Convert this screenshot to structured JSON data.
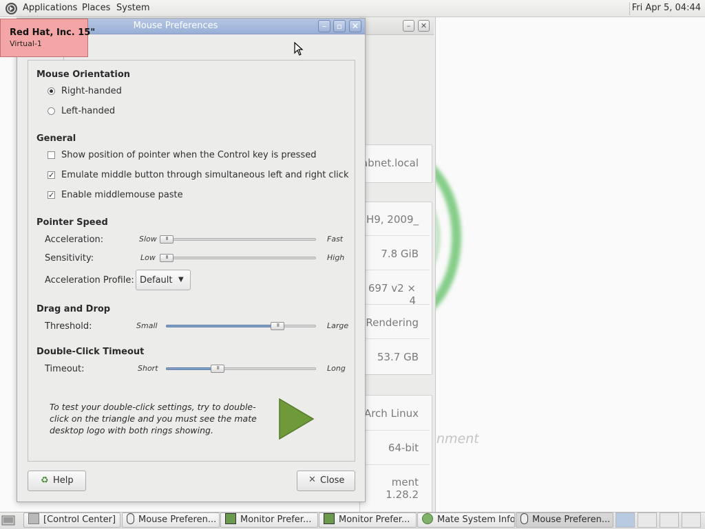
{
  "top_panel": {
    "menus": [
      "Applications",
      "Places",
      "System"
    ],
    "clock": "Fri Apr  5, 04:44"
  },
  "tooltip": {
    "title": "Red Hat, Inc. 15\"",
    "subtitle": "Virtual-1"
  },
  "background_window": {
    "values": [
      "abnet.local",
      "H9, 2009_",
      "7.8 GiB",
      "697 v2 × 4",
      "Rendering",
      "53.7 GB",
      "Arch Linux",
      "64-bit",
      "ment 1.28.2"
    ],
    "partial_text": "nment"
  },
  "dialog": {
    "title": "Mouse Preferences",
    "orientation": {
      "heading": "Mouse Orientation",
      "right_handed": "Right-handed",
      "left_handed": "Left-handed",
      "selected": "Right-handed"
    },
    "general": {
      "heading": "General",
      "show_position": "Show position of pointer when the Control key is pressed",
      "show_position_checked": false,
      "emulate_middle": "Emulate middle button through simultaneous left and right click",
      "emulate_middle_checked": true,
      "middle_paste": "Enable middlemouse paste",
      "middle_paste_checked": true
    },
    "pointer_speed": {
      "heading": "Pointer Speed",
      "acceleration_label": "Acceleration:",
      "acceleration_min": "Slow",
      "acceleration_max": "Fast",
      "acceleration_value": 0.0,
      "sensitivity_label": "Sensitivity:",
      "sensitivity_min": "Low",
      "sensitivity_max": "High",
      "sensitivity_value": 0.0,
      "profile_label": "Acceleration Profile:",
      "profile_value": "Default"
    },
    "drag_drop": {
      "heading": "Drag and Drop",
      "threshold_label": "Threshold:",
      "threshold_min": "Small",
      "threshold_max": "Large",
      "threshold_value": 0.77
    },
    "double_click": {
      "heading": "Double-Click Timeout",
      "timeout_label": "Timeout:",
      "timeout_min": "Short",
      "timeout_max": "Long",
      "timeout_value": 0.33,
      "hint": "To test your double-click settings, try to double-click on the triangle and you must see the mate desktop logo with both rings showing."
    },
    "buttons": {
      "help": "Help",
      "close": "Close"
    }
  },
  "taskbar": {
    "tasks": [
      "[Control Center]",
      "Mouse Preferen...",
      "Monitor Prefer...",
      "Monitor Prefer...",
      "Mate System Info",
      "Mouse Preferen..."
    ]
  },
  "colors": {
    "titlebar_active": "#a9bde0",
    "slider_fill": "#7e9dc5",
    "tooltip_bg": "#f4a6a6",
    "play_triangle": "#6e9a3a"
  }
}
